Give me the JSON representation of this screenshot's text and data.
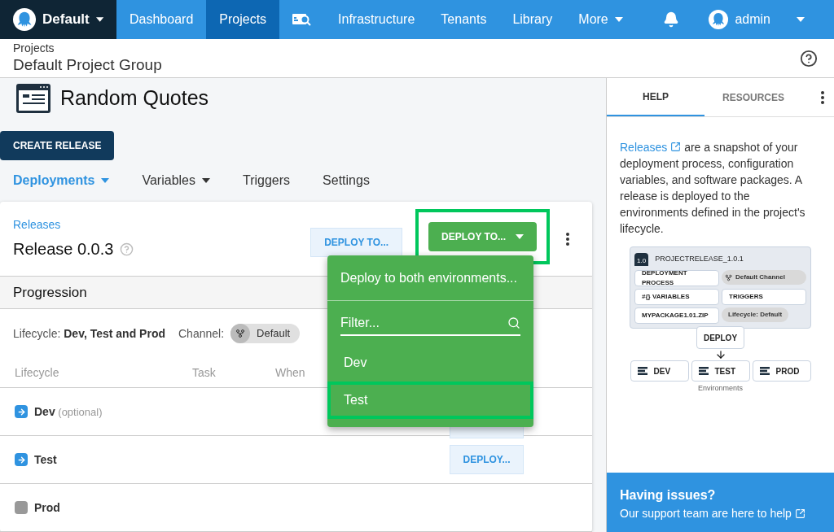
{
  "nav": {
    "org": "Default",
    "items": [
      {
        "label": "Dashboard",
        "kind": "text",
        "selected": false
      },
      {
        "label": "Projects",
        "kind": "text",
        "selected": true
      },
      {
        "kind": "icon",
        "selected": false
      },
      {
        "label": "Infrastructure",
        "kind": "text",
        "selected": false
      },
      {
        "label": "Tenants",
        "kind": "text",
        "selected": false
      },
      {
        "label": "Library",
        "kind": "text",
        "selected": false
      },
      {
        "label": "More",
        "kind": "dropdown",
        "selected": false
      }
    ],
    "user": "admin"
  },
  "breadcrumb": {
    "parent": "Projects",
    "title": "Default Project Group"
  },
  "project": {
    "name": "Random Quotes",
    "create_button": "CREATE RELEASE",
    "tabs": [
      {
        "label": "Deployments",
        "dropdown": true,
        "selected": true
      },
      {
        "label": "Variables",
        "dropdown": true,
        "selected": false
      },
      {
        "label": "Triggers",
        "dropdown": false,
        "selected": false
      },
      {
        "label": "Settings",
        "dropdown": false,
        "selected": false
      }
    ]
  },
  "release": {
    "link": "Releases",
    "title": "Release 0.0.3",
    "deploy_secondary": "DEPLOY TO...",
    "deploy_primary": "DEPLOY TO...",
    "primary_highlighted": true,
    "progression": "Progression",
    "lifecycle_label": "Lifecycle:",
    "lifecycle": "Dev, Test and Prod",
    "channel_label": "Channel:",
    "channel": "Default",
    "columns": [
      "Lifecycle",
      "Task",
      "When"
    ],
    "rows": [
      {
        "name": "Dev",
        "note": "(optional)",
        "kind": "next",
        "deploy_covered": true
      },
      {
        "name": "Test",
        "kind": "next",
        "deploy": "DEPLOY..."
      },
      {
        "name": "Prod",
        "kind": "inactive"
      }
    ]
  },
  "menu": {
    "header": "Deploy to both environments...",
    "filter_placeholder": "Filter...",
    "items": [
      {
        "label": "Dev",
        "highlighted": false
      },
      {
        "label": "Test",
        "highlighted": true
      }
    ]
  },
  "help": {
    "tabs": [
      {
        "label": "HELP",
        "selected": true
      },
      {
        "label": "RESOURCES",
        "selected": false
      }
    ],
    "link": "Releases",
    "text": "are a snapshot of your deployment process, configuration variables, and software packages. A release is deployed to the environments defined in the project's lifecycle.",
    "diagram": {
      "release": "PROJECTRELEASE_1.0.1",
      "version": "1.0",
      "process": "DEPLOYMENT PROCESS",
      "channel": "Default Channel",
      "variables": "#{} VARIABLES",
      "triggers": "TRIGGERS",
      "package": "MYPACKAGE1.01.ZIP",
      "lifecycle": "Lifecycle: Default",
      "deploy": "DEPLOY",
      "environments": [
        "DEV",
        "TEST",
        "PROD"
      ],
      "caption": "Environments"
    },
    "issues_title": "Having issues?",
    "issues_link": "Our support team are here to help"
  }
}
